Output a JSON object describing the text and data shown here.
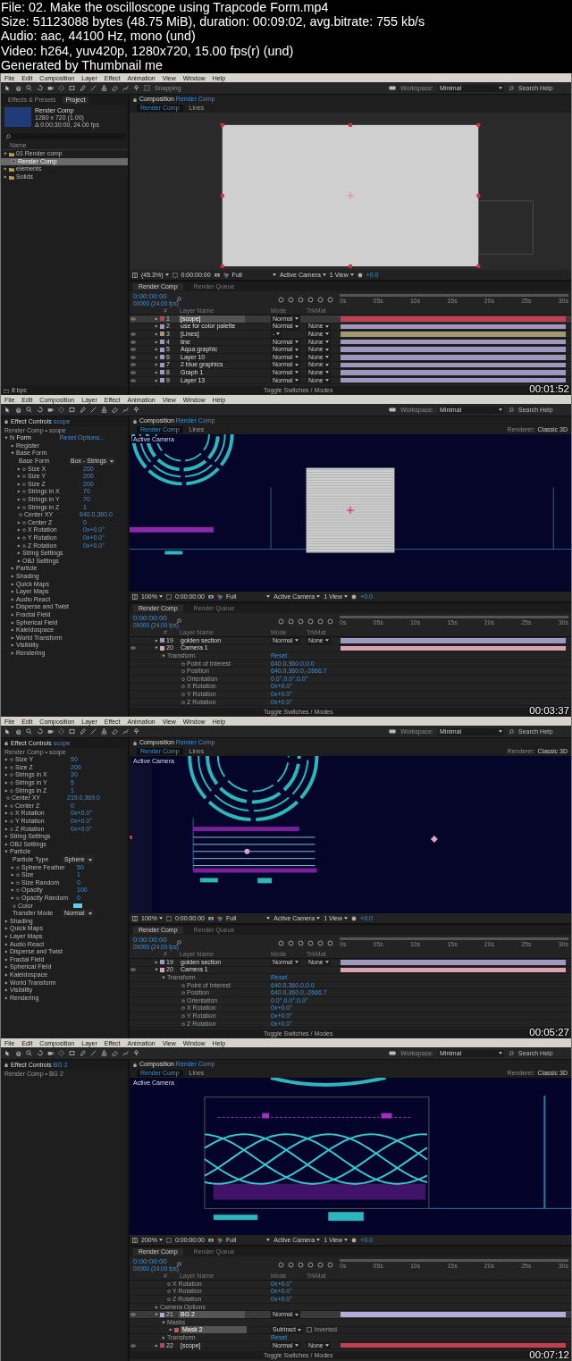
{
  "header": {
    "lines": [
      "File: 02. Make the oscilloscope using Trapcode Form.mp4",
      "Size: 51123088 bytes (48.75 MiB), duration: 00:09:02, avg.bitrate: 755 kb/s",
      "Audio: aac, 44100 Hz, mono (und)",
      "Video: h264, yuv420p, 1280x720, 15.00 fps(r) (und)",
      "Generated by Thumbnail me"
    ]
  },
  "frames": [
    {
      "timestamp": "00:01:52",
      "menu": [
        "File",
        "Edit",
        "Composition",
        "Layer",
        "Effect",
        "Animation",
        "View",
        "Window",
        "Help"
      ],
      "toolbar": {
        "snapping": {
          "label": "Snapping",
          "checked": false
        },
        "workspace_label": "Workspace:",
        "workspace": "Minimal",
        "search_placeholder": "Search Help"
      },
      "left_panel": {
        "kind": "project",
        "tabs": [
          {
            "label": "Effects & Presets",
            "selected": false
          },
          {
            "label": "Project",
            "selected": true
          }
        ],
        "comp_name": "Render Comp",
        "comp_size": "1280 x 720 (1.00)",
        "comp_duration": "Δ 0:00:30:00, 24.00 fps",
        "column": "Name",
        "items": [
          {
            "label": "01 Render comp",
            "kind": "folder",
            "selected": false,
            "expanded": true,
            "children": [
              {
                "label": "Render Comp",
                "kind": "comp",
                "selected": true
              }
            ]
          },
          {
            "label": "elements",
            "kind": "folder",
            "selected": false,
            "expanded": false
          },
          {
            "label": "Solids",
            "kind": "folder",
            "selected": false,
            "expanded": false
          }
        ],
        "footer": "8 bpc"
      },
      "composition": {
        "tab_label": "Composition",
        "comp_name": "Render Comp",
        "breadcrumbs": [
          {
            "label": "Render Comp",
            "selected": true
          },
          {
            "label": "Lines",
            "selected": false
          }
        ],
        "viewer": {
          "kind": "blank"
        },
        "toolbar": {
          "zoom": "(45.3%)",
          "time": "0:00:00:00",
          "resolution": "Full",
          "camera": "Active Camera",
          "views": "1 View",
          "exposure": "+0.0"
        }
      },
      "timeline": {
        "tabs": [
          {
            "label": "Render Comp",
            "selected": true
          },
          {
            "label": "Render Queue",
            "selected": false
          }
        ],
        "timecode": "0:00:00:00",
        "fps": "00000 (24.00 fps)",
        "columns": {
          "number": "#",
          "name": "Layer Name",
          "mode": "Mode",
          "trkmat": "TrkMat"
        },
        "ticks": [
          "0s",
          "05s",
          "10s",
          "15s",
          "20s",
          "25s",
          "30s"
        ],
        "rows": [
          {
            "kind": "layer",
            "number": "1",
            "name": "[scope]",
            "color": "#c0404f",
            "visible": true,
            "selected": true,
            "expanded": false,
            "mode": "Normal"
          },
          {
            "kind": "layer",
            "number": "2",
            "name": "use for color palette",
            "color": "#9d97c2",
            "visible": false,
            "selected": false,
            "expanded": false,
            "mode": "Normal",
            "trkmat": "None"
          },
          {
            "kind": "layer",
            "number": "3",
            "name": "[Lines]",
            "color": "#a39a70",
            "visible": true,
            "selected": false,
            "expanded": false,
            "mode": "-",
            "trkmat": "None"
          },
          {
            "kind": "layer",
            "number": "4",
            "name": "line",
            "color": "#9d97c2",
            "visible": true,
            "selected": false,
            "expanded": false,
            "mode": "Normal",
            "trkmat": "None"
          },
          {
            "kind": "layer",
            "number": "5",
            "name": "Aqua graphic",
            "color": "#9d97c2",
            "visible": true,
            "selected": false,
            "expanded": false,
            "mode": "Normal",
            "trkmat": "None"
          },
          {
            "kind": "layer",
            "number": "6",
            "name": "Layer 10",
            "color": "#9d97c2",
            "visible": true,
            "selected": false,
            "expanded": false,
            "mode": "Normal",
            "trkmat": "None"
          },
          {
            "kind": "layer",
            "number": "7",
            "name": "2 blue graphics",
            "color": "#9d97c2",
            "visible": true,
            "selected": false,
            "expanded": false,
            "mode": "Normal",
            "trkmat": "None"
          },
          {
            "kind": "layer",
            "number": "8",
            "name": "Graph 1",
            "color": "#9d97c2",
            "visible": true,
            "selected": false,
            "expanded": false,
            "mode": "Normal",
            "trkmat": "None"
          },
          {
            "kind": "layer",
            "number": "9",
            "name": "Layer 13",
            "color": "#9d97c2",
            "visible": true,
            "selected": false,
            "expanded": false,
            "mode": "Normal",
            "trkmat": "None"
          }
        ],
        "footer": "Toggle Switches / Modes"
      }
    },
    {
      "timestamp": "00:03:37",
      "menu": [
        "File",
        "Edit",
        "Composition",
        "Layer",
        "Effect",
        "Animation",
        "View",
        "Window",
        "Help"
      ],
      "toolbar": {
        "workspace_label": "Workspace:",
        "workspace": "Minimal",
        "search_placeholder": "Search Help"
      },
      "left_panel": {
        "kind": "effect_controls",
        "title": "Effect Controls",
        "layer": "scope",
        "breadcrumb": "Render Comp • scope",
        "items": [
          {
            "kind": "effect",
            "badge": "fx",
            "label": "Form",
            "reset": "Reset",
            "options": "Options...",
            "expanded": true,
            "children": [
              {
                "kind": "group",
                "label": "Register",
                "expanded": false
              },
              {
                "kind": "group",
                "label": "Base Form",
                "expanded": true,
                "children": [
                  {
                    "kind": "dropdown",
                    "label": "Base Form",
                    "value": "Box - Strings"
                  },
                  {
                    "kind": "property",
                    "label": "Size X",
                    "value": "200",
                    "expanded": false
                  },
                  {
                    "kind": "property",
                    "label": "Size Y",
                    "value": "200",
                    "expanded": false
                  },
                  {
                    "kind": "property",
                    "label": "Size Z",
                    "value": "200",
                    "expanded": false
                  },
                  {
                    "kind": "property",
                    "label": "Strings in X",
                    "value": "70",
                    "expanded": false
                  },
                  {
                    "kind": "property",
                    "label": "Strings in Y",
                    "value": "70",
                    "expanded": false
                  },
                  {
                    "kind": "property",
                    "label": "Strings in Z",
                    "value": "1",
                    "expanded": false
                  },
                  {
                    "kind": "property",
                    "label": "Center XY",
                    "value": "640.0,360.0"
                  },
                  {
                    "kind": "property",
                    "label": "Center Z",
                    "value": "0",
                    "expanded": false
                  },
                  {
                    "kind": "property",
                    "label": "X Rotation",
                    "value": "0x+0.0°",
                    "expanded": false
                  },
                  {
                    "kind": "property",
                    "label": "Y Rotation",
                    "value": "0x+0.0°",
                    "expanded": false
                  },
                  {
                    "kind": "property",
                    "label": "Z Rotation",
                    "value": "0x+0.0°",
                    "expanded": false
                  },
                  {
                    "kind": "group",
                    "label": "String Settings",
                    "expanded": false
                  },
                  {
                    "kind": "group",
                    "label": "OBJ Settings",
                    "expanded": false
                  }
                ]
              },
              {
                "kind": "group",
                "label": "Particle",
                "expanded": false
              },
              {
                "kind": "group",
                "label": "Shading",
                "expanded": false
              },
              {
                "kind": "group",
                "label": "Quick Maps",
                "expanded": false
              },
              {
                "kind": "group",
                "label": "Layer Maps",
                "expanded": false
              },
              {
                "kind": "group",
                "label": "Audio React",
                "expanded": false
              },
              {
                "kind": "group",
                "label": "Disperse and Twist",
                "expanded": false
              },
              {
                "kind": "group",
                "label": "Fractal Field",
                "expanded": false
              },
              {
                "kind": "group",
                "label": "Spherical Field",
                "expanded": false
              },
              {
                "kind": "group",
                "label": "Kaleidospace",
                "expanded": false
              },
              {
                "kind": "group",
                "label": "World Transform",
                "expanded": false
              },
              {
                "kind": "group",
                "label": "Visibility",
                "expanded": false
              },
              {
                "kind": "group",
                "label": "Rendering",
                "expanded": false
              }
            ]
          }
        ]
      },
      "composition": {
        "tab_label": "Composition",
        "comp_name": "Render Comp",
        "breadcrumbs": [
          {
            "label": "Render Comp",
            "selected": true
          },
          {
            "label": "Lines",
            "selected": false
          }
        ],
        "renderer_label": "Renderer:",
        "renderer": "Classic 3D",
        "camera_label": "Active Camera",
        "viewer": {
          "kind": "rings"
        },
        "toolbar": {
          "zoom": "100%",
          "time": "0:00:00:00",
          "resolution": "Full",
          "camera": "Active Camera",
          "views": "1 View",
          "exposure": "+0.0"
        }
      },
      "timeline": {
        "tabs": [
          {
            "label": "Render Comp",
            "selected": true
          },
          {
            "label": "Render Queue",
            "selected": false
          }
        ],
        "timecode": "0:00:00:00",
        "fps": "00000 (24.00 fps)",
        "columns": {
          "number": "#",
          "name": "Layer Name",
          "mode": "Mode",
          "trkmat": "TrkMat"
        },
        "ticks": [
          "0s",
          "05s",
          "10s",
          "15s",
          "20s",
          "25s",
          "30s"
        ],
        "rows": [
          {
            "kind": "layer",
            "number": "19",
            "name": "golden section",
            "color": "#9d97c2",
            "visible": false,
            "selected": false,
            "expanded": false,
            "mode": "Normal",
            "trkmat": "None"
          },
          {
            "kind": "layer",
            "number": "20",
            "name": "Camera 1",
            "color": "#d8a2b0",
            "visible": true,
            "selected": false,
            "expanded": true,
            "children": [
              {
                "kind": "group",
                "name": "Transform",
                "value": "Reset",
                "expanded": true,
                "children": [
                  {
                    "kind": "property",
                    "name": "Point of Interest",
                    "value": "640.0,360.0,0.0"
                  },
                  {
                    "kind": "property",
                    "name": "Position",
                    "value": "640.0,360.0,-2666.7"
                  },
                  {
                    "kind": "property",
                    "name": "Orientation",
                    "value": "0.0°,0.0°,0.0°"
                  },
                  {
                    "kind": "property",
                    "name": "X Rotation",
                    "value": "0x+0.0°"
                  },
                  {
                    "kind": "property",
                    "name": "Y Rotation",
                    "value": "0x+0.0°"
                  },
                  {
                    "kind": "property",
                    "name": "Z Rotation",
                    "value": "0x+0.0°"
                  }
                ]
              }
            ]
          }
        ],
        "footer": "Toggle Switches / Modes"
      }
    },
    {
      "timestamp": "00:05:27",
      "menu": [
        "File",
        "Edit",
        "Composition",
        "Layer",
        "Effect",
        "Animation",
        "View",
        "Window",
        "Help"
      ],
      "toolbar": {
        "workspace_label": "Workspace:",
        "workspace": "Minimal",
        "search_placeholder": "Search Help"
      },
      "left_panel": {
        "kind": "effect_controls",
        "title": "Effect Controls",
        "layer": "scope",
        "breadcrumb": "Render Comp • scope",
        "items": [
          {
            "kind": "property",
            "label": "Size Y",
            "value": "50",
            "expanded": false
          },
          {
            "kind": "property",
            "label": "Size Z",
            "value": "200",
            "expanded": false
          },
          {
            "kind": "property",
            "label": "Strings in X",
            "value": "30",
            "expanded": false
          },
          {
            "kind": "property",
            "label": "Strings in Y",
            "value": "5",
            "expanded": false
          },
          {
            "kind": "property",
            "label": "Strings in Z",
            "value": "1",
            "expanded": false
          },
          {
            "kind": "property",
            "label": "Center XY",
            "value": "219.0,369.0"
          },
          {
            "kind": "property",
            "label": "Center Z",
            "value": "0",
            "expanded": false
          },
          {
            "kind": "property",
            "label": "X Rotation",
            "value": "0x+0.0°",
            "expanded": false
          },
          {
            "kind": "property",
            "label": "Y Rotation",
            "value": "0x+0.0°",
            "expanded": false
          },
          {
            "kind": "property",
            "label": "Z Rotation",
            "value": "0x+0.0°",
            "expanded": false
          },
          {
            "kind": "group",
            "label": "String Settings",
            "expanded": false
          },
          {
            "kind": "group",
            "label": "OBJ Settings",
            "expanded": false
          },
          {
            "kind": "group",
            "label": "Particle",
            "expanded": true,
            "children": [
              {
                "kind": "dropdown",
                "label": "Particle Type",
                "value": "Sphere"
              },
              {
                "kind": "property",
                "label": "Sphere Feather",
                "value": "50",
                "expanded": false
              },
              {
                "kind": "property",
                "label": "Size",
                "value": "1",
                "expanded": false
              },
              {
                "kind": "property",
                "label": "Size Random",
                "value": "0",
                "expanded": false
              },
              {
                "kind": "property",
                "label": "Opacity",
                "value": "100",
                "expanded": false
              },
              {
                "kind": "property",
                "label": "Opacity Random",
                "value": "0",
                "expanded": false
              },
              {
                "kind": "color",
                "label": "Color",
                "color": "#5ecfe8"
              },
              {
                "kind": "dropdown",
                "label": "Transfer Mode",
                "value": "Normal"
              }
            ]
          },
          {
            "kind": "group",
            "label": "Shading",
            "expanded": false
          },
          {
            "kind": "group",
            "label": "Quick Maps",
            "expanded": false
          },
          {
            "kind": "group",
            "label": "Layer Maps",
            "expanded": false
          },
          {
            "kind": "group",
            "label": "Audio React",
            "expanded": false
          },
          {
            "kind": "group",
            "label": "Disperse and Twist",
            "expanded": false
          },
          {
            "kind": "group",
            "label": "Fractal Field",
            "expanded": false
          },
          {
            "kind": "group",
            "label": "Spherical Field",
            "expanded": false
          },
          {
            "kind": "group",
            "label": "Kaleidospace",
            "expanded": false
          },
          {
            "kind": "group",
            "label": "World Transform",
            "expanded": false
          },
          {
            "kind": "group",
            "label": "Visibility",
            "expanded": false
          },
          {
            "kind": "group",
            "label": "Rendering",
            "expanded": false
          }
        ]
      },
      "composition": {
        "tab_label": "Composition",
        "comp_name": "Render Comp",
        "breadcrumbs": [
          {
            "label": "Render Comp",
            "selected": true
          },
          {
            "label": "Lines",
            "selected": false
          }
        ],
        "renderer_label": "Renderer:",
        "renderer": "Classic 3D",
        "camera_label": "Active Camera",
        "viewer": {
          "kind": "lines"
        },
        "toolbar": {
          "zoom": "100%",
          "time": "0:00:00:00",
          "resolution": "Full",
          "camera": "Active Camera",
          "views": "1 View",
          "exposure": "+0.0"
        }
      },
      "timeline": {
        "tabs": [
          {
            "label": "Render Comp",
            "selected": true
          },
          {
            "label": "Render Queue",
            "selected": false
          }
        ],
        "timecode": "0:00:00:00",
        "fps": "00000 (24.00 fps)",
        "columns": {
          "number": "#",
          "name": "Layer Name",
          "mode": "Mode",
          "trkmat": "TrkMat"
        },
        "ticks": [
          "0s",
          "05s",
          "10s",
          "15s",
          "20s",
          "25s",
          "30s"
        ],
        "rows": [
          {
            "kind": "layer",
            "number": "19",
            "name": "golden section",
            "color": "#9d97c2",
            "visible": false,
            "selected": false,
            "expanded": false,
            "mode": "Normal",
            "trkmat": "None"
          },
          {
            "kind": "layer",
            "number": "20",
            "name": "Camera 1",
            "color": "#d8a2b0",
            "visible": true,
            "selected": false,
            "expanded": true,
            "children": [
              {
                "kind": "group",
                "name": "Transform",
                "value": "Reset",
                "expanded": true,
                "children": [
                  {
                    "kind": "property",
                    "name": "Point of Interest",
                    "value": "640.0,360.0,0.0"
                  },
                  {
                    "kind": "property",
                    "name": "Position",
                    "value": "640.0,360.0,-2666.7"
                  },
                  {
                    "kind": "property",
                    "name": "Orientation",
                    "value": "0.0°,0.0°,0.0°"
                  },
                  {
                    "kind": "property",
                    "name": "X Rotation",
                    "value": "0x+0.0°"
                  },
                  {
                    "kind": "property",
                    "name": "Y Rotation",
                    "value": "0x+0.0°"
                  },
                  {
                    "kind": "property",
                    "name": "Z Rotation",
                    "value": "0x+0.0°"
                  }
                ]
              }
            ]
          }
        ],
        "footer": "Toggle Switches / Modes"
      }
    },
    {
      "timestamp": "00:07:12",
      "menu": [
        "File",
        "Edit",
        "Composition",
        "Layer",
        "Effect",
        "Animation",
        "View",
        "Window",
        "Help"
      ],
      "toolbar": {
        "workspace_label": "Workspace:",
        "workspace": "Minimal",
        "search_placeholder": "Search Help"
      },
      "left_panel": {
        "kind": "effect_controls",
        "title": "Effect Controls",
        "layer": "BG 2",
        "breadcrumb": "Render Comp • BG 2"
      },
      "composition": {
        "tab_label": "Composition",
        "comp_name": "Render Comp",
        "breadcrumbs": [
          {
            "label": "Render Comp",
            "selected": true
          },
          {
            "label": "Lines",
            "selected": false
          }
        ],
        "renderer_label": "Renderer:",
        "renderer": "Classic 3D",
        "camera_label": "Active Camera",
        "viewer": {
          "kind": "waves"
        },
        "toolbar": {
          "zoom": "200%",
          "time": "0:00:00:00",
          "resolution": "Full",
          "camera": "Active Camera",
          "views": "1 View",
          "exposure": "+0.0"
        }
      },
      "timeline": {
        "tabs": [
          {
            "label": "Render Comp",
            "selected": true
          },
          {
            "label": "Render Queue",
            "selected": false
          }
        ],
        "timecode": "0:00:00:00",
        "fps": "00000 (24.00 fps)",
        "columns": {
          "number": "#",
          "name": "Layer Name",
          "mode": "Mode",
          "trkmat": "TrkMat"
        },
        "ticks": [
          "0s",
          "05s",
          "10s",
          "15s",
          "20s",
          "25s",
          "30s"
        ],
        "rows": [
          {
            "kind": "property",
            "name": "X Rotation",
            "value": "0x+0.0°"
          },
          {
            "kind": "property",
            "name": "Y Rotation",
            "value": "0x+0.0°"
          },
          {
            "kind": "property",
            "name": "Z Rotation",
            "value": "0x+0.0°"
          },
          {
            "kind": "group",
            "name": "Camera Options",
            "expanded": false
          },
          {
            "kind": "layer",
            "number": "21",
            "name": "BG 2",
            "color": "#b3acd9",
            "visible": true,
            "selected": true,
            "expanded": true,
            "mode": "Normal",
            "children": [
              {
                "kind": "group",
                "name": "Masks",
                "expanded": true,
                "children": [
                  {
                    "kind": "mask",
                    "name": "Mask 2",
                    "color": "#c05a4a",
                    "expanded": false,
                    "mode": "Subtract",
                    "inverted_label": "Inverted",
                    "inverted": false
                  }
                ]
              },
              {
                "kind": "group",
                "name": "Transform",
                "value": "Reset",
                "expanded": false
              }
            ]
          },
          {
            "kind": "layer",
            "number": "22",
            "name": "[scope]",
            "color": "#c0404f",
            "visible": true,
            "selected": false,
            "expanded": false,
            "mode": "Normal",
            "trkmat": "None"
          }
        ],
        "footer": "Toggle Switches / Modes"
      }
    }
  ]
}
